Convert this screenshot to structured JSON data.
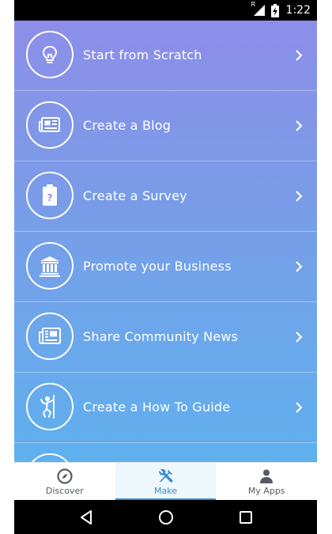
{
  "status_bar": {
    "time": "1:22",
    "signal_badge": "R",
    "icons": [
      "signal-icon",
      "battery-charging-icon"
    ]
  },
  "menu": {
    "items": [
      {
        "label": "Start from Scratch",
        "icon": "lightbulb-icon"
      },
      {
        "label": "Create a Blog",
        "icon": "newspaper-icon"
      },
      {
        "label": "Create a Survey",
        "icon": "clipboard-question-icon"
      },
      {
        "label": "Promote your Business",
        "icon": "bank-building-icon"
      },
      {
        "label": "Share Community News",
        "icon": "news-document-icon"
      },
      {
        "label": "Create a How To Guide",
        "icon": "climbing-person-icon"
      },
      {
        "label": "",
        "icon": "partially-visible-item-icon"
      }
    ]
  },
  "tabbar": {
    "tabs": [
      {
        "label": "Discover",
        "icon": "compass-icon",
        "active": false
      },
      {
        "label": "Make",
        "icon": "tools-icon",
        "active": true
      },
      {
        "label": "My Apps",
        "icon": "person-icon",
        "active": false
      }
    ]
  },
  "nav_bar": {
    "buttons": [
      "back-icon",
      "home-icon",
      "recents-icon"
    ]
  },
  "colors": {
    "gradient_top": "#8d8ee9",
    "gradient_bottom": "#5fb0ee",
    "active_tab": "#3b8fd0",
    "inactive_tab": "#555a66"
  }
}
